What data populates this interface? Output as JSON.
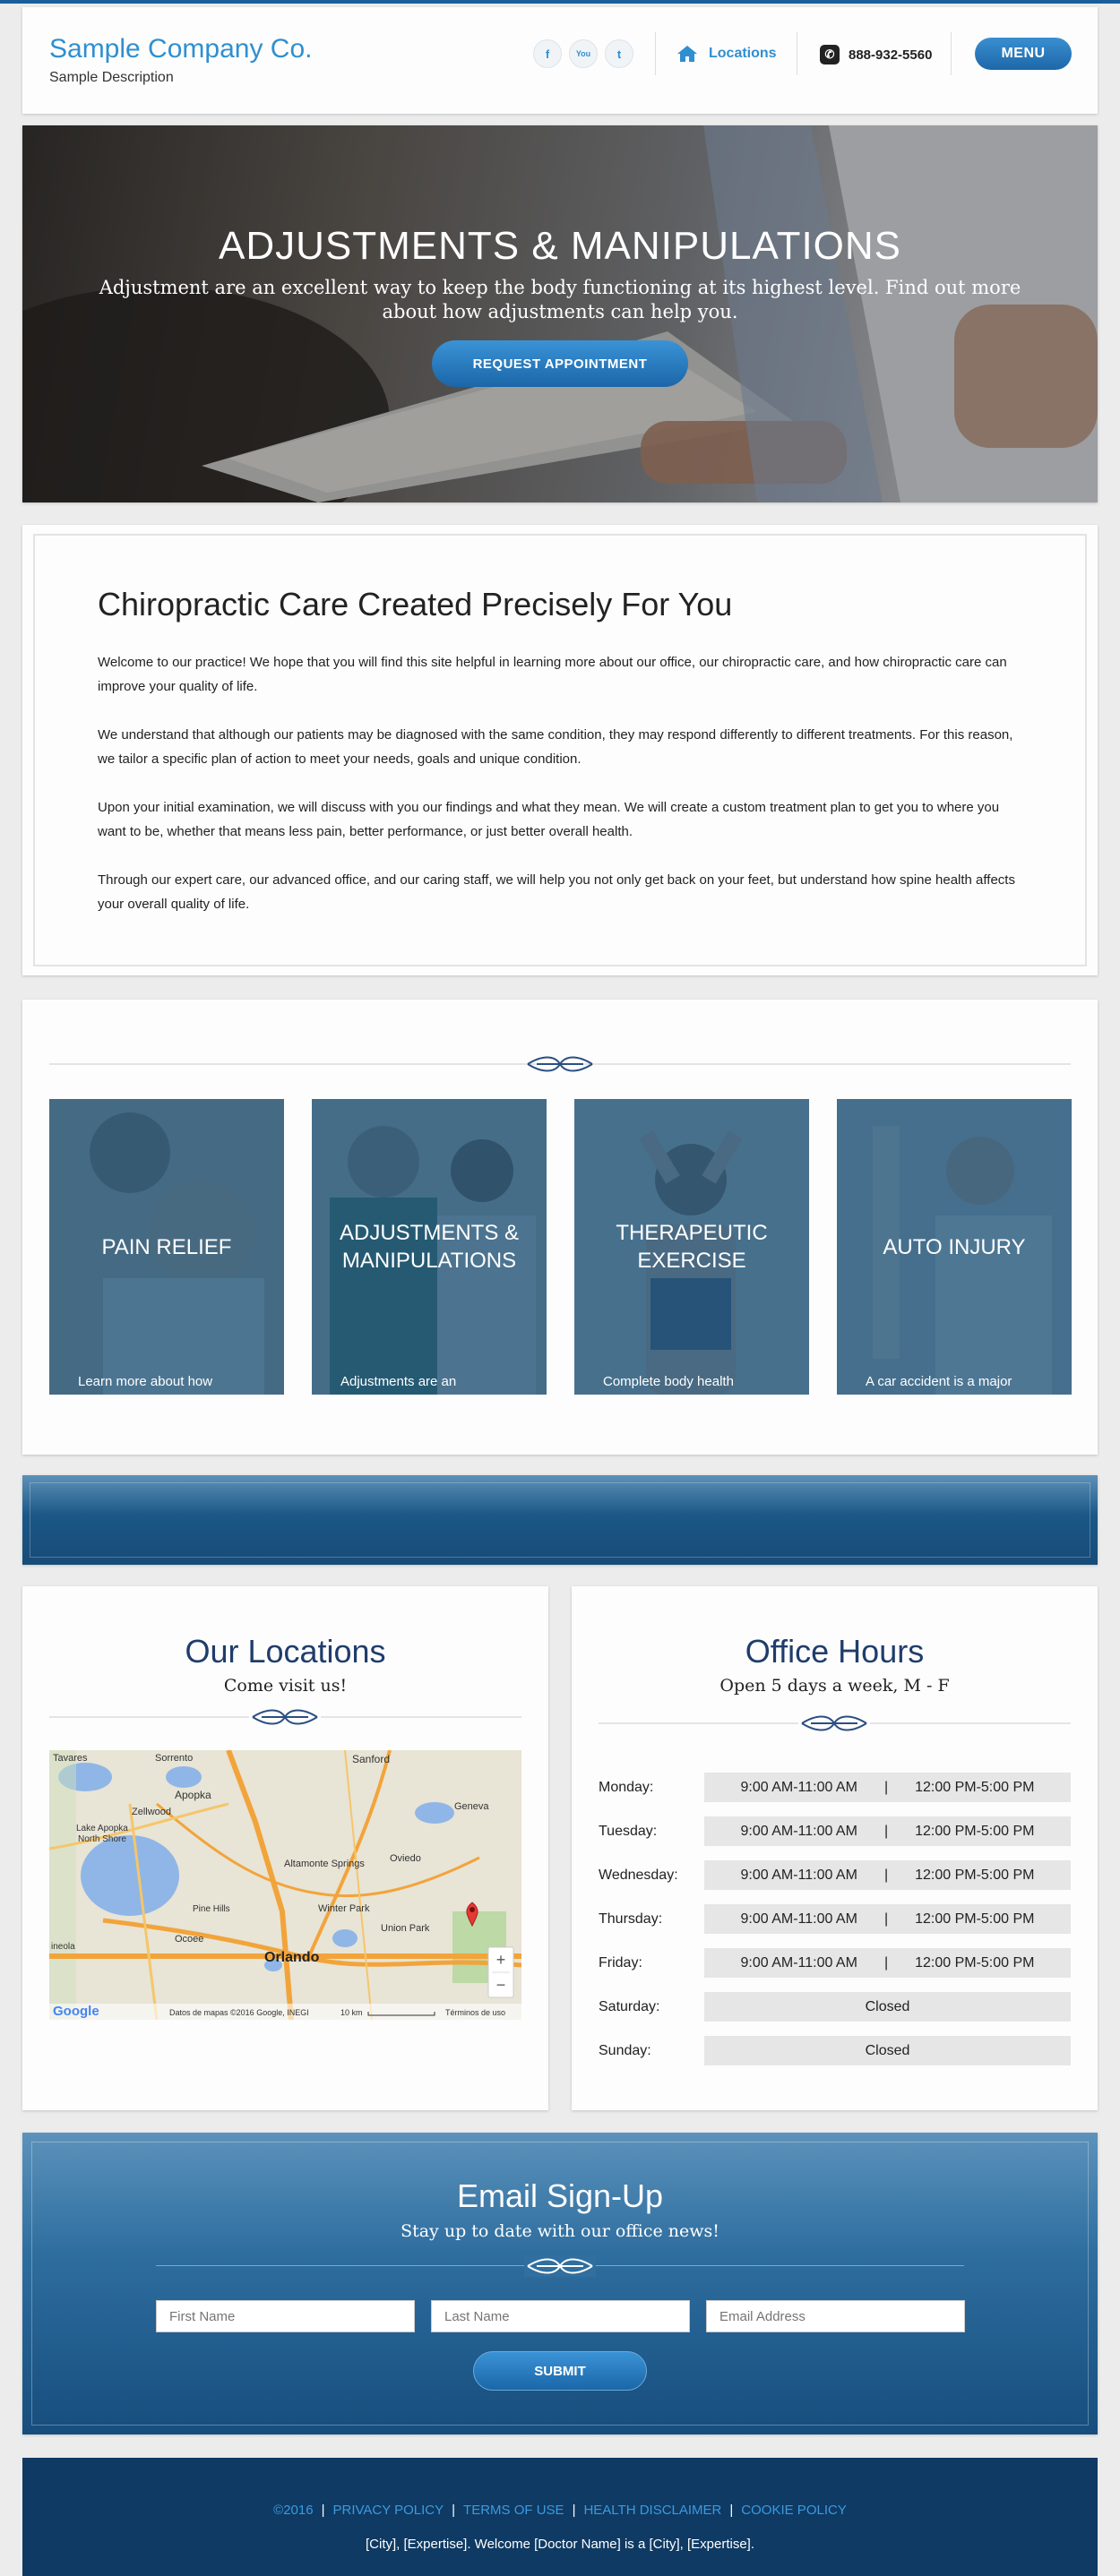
{
  "header": {
    "brand_name": "Sample Company Co.",
    "brand_desc": "Sample Description",
    "social": [
      "f",
      "You",
      "t"
    ],
    "locations_label": "Locations",
    "phone": "888-932-5560",
    "menu_label": "MENU"
  },
  "hero": {
    "title": "ADJUSTMENTS & MANIPULATIONS",
    "subtitle": "Adjustment are an excellent way to keep the body functioning at its highest level. Find out more about how adjustments can help you.",
    "button": "REQUEST APPOINTMENT"
  },
  "intro": {
    "title": "Chiropractic Care Created Precisely For You",
    "paragraphs": [
      "Welcome to our practice! We hope that you will find this site helpful in learning more about our office, our chiropractic care, and how chiropractic care can improve your quality of life.",
      "We understand that although our patients may be diagnosed with the same condition, they may respond differently to different treatments. For this reason, we tailor a specific plan of action to meet your needs, goals and unique condition.",
      "Upon your initial examination, we will discuss with you our findings and what they mean. We will create a custom treatment plan to get you to where you want to be, whether that means less pain, better performance, or just better overall health.",
      "Through our expert care, our advanced office, and our caring staff, we will help you not only get back on your feet, but understand how spine health affects your overall quality of life."
    ]
  },
  "services": [
    {
      "title": "PAIN RELIEF",
      "text": "Learn more about how"
    },
    {
      "title": "ADJUSTMENTS & MANIPULATIONS",
      "text": "Adjustments are an"
    },
    {
      "title": "THERAPEUTIC EXERCISE",
      "text": "Complete body health"
    },
    {
      "title": "AUTO INJURY",
      "text": "A car accident is a major"
    }
  ],
  "locations": {
    "title": "Our Locations",
    "subtitle": "Come visit us!",
    "map": {
      "labels": [
        "Tavares",
        "Sorrento",
        "Sanford",
        "Zellwood",
        "Lake Apopka",
        "North Shore",
        "Apopka",
        "Altamonte Springs",
        "Oviedo",
        "Geneva",
        "Winter Park",
        "Union Park",
        "Ocoee",
        "Orlando",
        "Pine Hills",
        "ineola"
      ],
      "attribution": "Datos de mapas ©2016 Google, INEGI",
      "scale": "10 km",
      "terms": "Términos de uso",
      "logo": "Google",
      "zoom_in": "+",
      "zoom_out": "−"
    }
  },
  "hours": {
    "title": "Office Hours",
    "subtitle": "Open 5 days a week, M - F",
    "rows": [
      {
        "day": "Monday:",
        "am": "9:00 AM-11:00 AM",
        "pm": "12:00 PM-5:00 PM"
      },
      {
        "day": "Tuesday:",
        "am": "9:00 AM-11:00 AM",
        "pm": "12:00 PM-5:00 PM"
      },
      {
        "day": "Wednesday:",
        "am": "9:00 AM-11:00 AM",
        "pm": "12:00 PM-5:00 PM"
      },
      {
        "day": "Thursday:",
        "am": "9:00 AM-11:00 AM",
        "pm": "12:00 PM-5:00 PM"
      },
      {
        "day": "Friday:",
        "am": "9:00 AM-11:00 AM",
        "pm": "12:00 PM-5:00 PM"
      },
      {
        "day": "Saturday:",
        "closed": "Closed"
      },
      {
        "day": "Sunday:",
        "closed": "Closed"
      }
    ],
    "separator": "|"
  },
  "email": {
    "title": "Email Sign-Up",
    "subtitle": "Stay up to date with our office news!",
    "first_placeholder": "First Name",
    "last_placeholder": "Last Name",
    "email_placeholder": "Email Address",
    "submit": "SUBMIT"
  },
  "footer": {
    "copyright": "©2016",
    "links": [
      "PRIVACY POLICY",
      "TERMS OF USE",
      "HEALTH DISCLAIMER",
      "COOKIE POLICY"
    ],
    "note": "[City], [Expertise]. Welcome [Doctor Name] is a [City], [Expertise]."
  },
  "colors": {
    "accent": "#2f8fd0",
    "heading_navy": "#1f3d6b",
    "footer_bg": "#0f3a63",
    "card_overlay": "#20547a"
  }
}
